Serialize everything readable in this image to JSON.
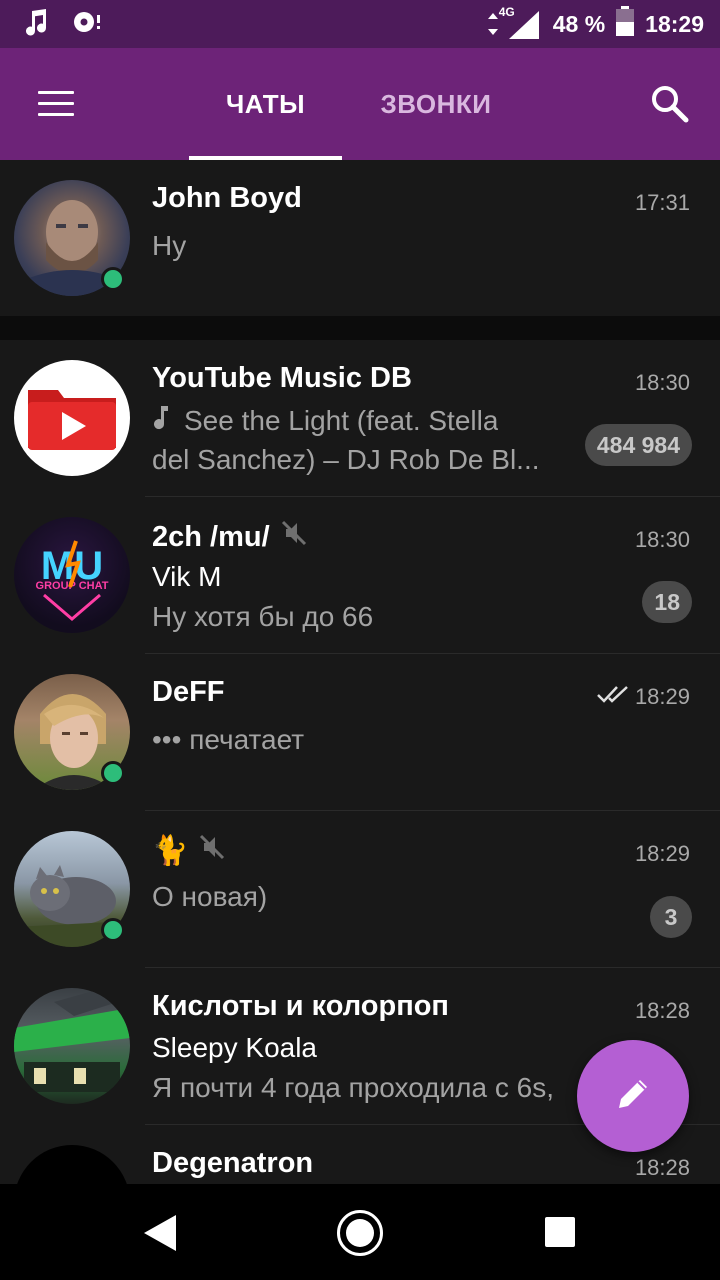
{
  "status_bar": {
    "network": "4G",
    "battery": "48 %",
    "time": "18:29",
    "icons": [
      "music-note-icon",
      "record-icon",
      "signal-icon",
      "battery-icon"
    ]
  },
  "toolbar": {
    "tabs": [
      {
        "label": "ЧАТЫ",
        "active": true
      },
      {
        "label": "ЗВОНКИ",
        "active": false
      }
    ],
    "icons": [
      "menu-icon",
      "search-icon"
    ]
  },
  "chats": [
    {
      "name": "John Boyd",
      "time": "17:31",
      "line1": "Ну",
      "online": true,
      "pinned": true
    },
    {
      "name": "YouTube Music DB",
      "time": "18:30",
      "line1": "See the Light (feat. Stella",
      "line2": "del Sanchez) – DJ Rob De Bl...",
      "badge": "484 984",
      "muted_badge": true
    },
    {
      "name": "2ch /mu/",
      "time": "18:30",
      "sender": "Vik M",
      "line2": "Ну хотя бы до 66",
      "badge": "18",
      "muted": true
    },
    {
      "name": "DeFF",
      "time": "18:29",
      "line1": "••• печатает",
      "online": true,
      "read": true
    },
    {
      "name": "🐈",
      "time": "18:29",
      "line1": "О новая)",
      "badge": "3",
      "muted": true,
      "online": true
    },
    {
      "name": "Кислоты и колорпоп",
      "time": "18:28",
      "sender": "Sleepy Koala",
      "line2": "Я почти 4 года проходила с 6s,",
      "badge": ""
    },
    {
      "name": "Degenatron",
      "time": "18:28"
    }
  ],
  "colors": {
    "status_bar": "#4d1b5a",
    "toolbar": "#6d2378",
    "fab": "#b45fd3",
    "online": "#2dbd7a",
    "background": "#181818"
  }
}
